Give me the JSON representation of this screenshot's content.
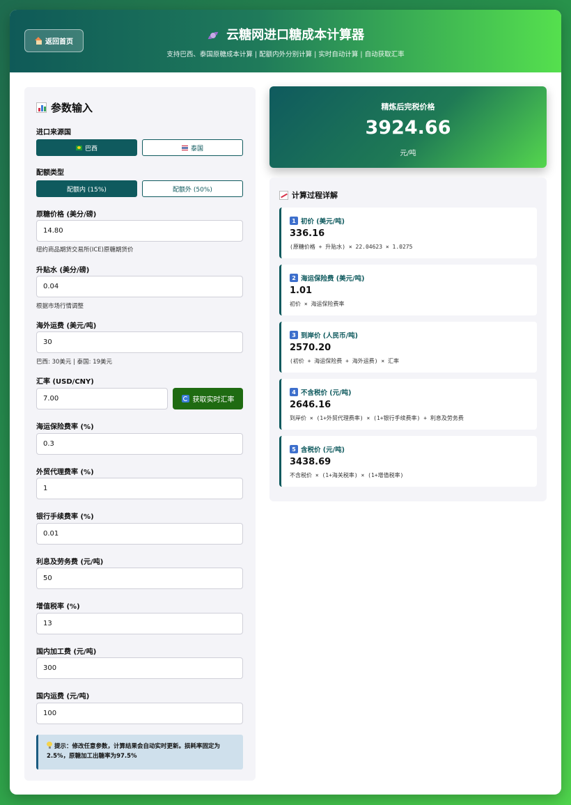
{
  "header": {
    "back_label": "返回首页",
    "title": "云糖网进口糖成本计算器",
    "subtitle": "支持巴西、泰国原糖成本计算 | 配额内外分别计算 | 实时自动计算 | 自动获取汇率"
  },
  "params": {
    "title": "参数输入",
    "origin_label": "进口来源国",
    "origin_options": [
      "巴西",
      "泰国"
    ],
    "origin_selected": "巴西",
    "quota_label": "配额类型",
    "quota_options": [
      "配额内 (15%)",
      "配额外 (50%)"
    ],
    "quota_selected": "配额内 (15%)",
    "raw_price": {
      "label": "原糖价格 (美分/磅)",
      "value": "14.80",
      "hint": "纽约商品期货交易所(ICE)原糖期货价"
    },
    "premium": {
      "label": "升贴水 (美分/磅)",
      "value": "0.04",
      "hint": "根据市场行情调整"
    },
    "freight": {
      "label": "海外运费 (美元/吨)",
      "value": "30",
      "hint": "巴西: 30美元 | 泰国: 19美元"
    },
    "exchange_rate": {
      "label": "汇率 (USD/CNY)",
      "value": "7.00",
      "button": "获取实时汇率"
    },
    "insurance_rate": {
      "label": "海运保险费率 (%)",
      "value": "0.3"
    },
    "agency_rate": {
      "label": "外贸代理费率 (%)",
      "value": "1"
    },
    "bank_rate": {
      "label": "银行手续费率 (%)",
      "value": "0.01"
    },
    "interest_fee": {
      "label": "利息及劳务费 (元/吨)",
      "value": "50"
    },
    "vat_rate": {
      "label": "增值税率 (%)",
      "value": "13"
    },
    "processing_fee": {
      "label": "国内加工费 (元/吨)",
      "value": "300"
    },
    "domestic_freight": {
      "label": "国内运费 (元/吨)",
      "value": "100"
    },
    "tip": "提示：修改任意参数，计算结果会自动实时更新。损耗率固定为2.5%，原糖加工出糖率为97.5%"
  },
  "result": {
    "label": "精炼后完税价格",
    "value": "3924.66",
    "unit": "元/吨"
  },
  "details": {
    "title": "计算过程详解",
    "steps": [
      {
        "num": "1",
        "name": "初价 (美元/吨)",
        "value": "336.16",
        "formula": "(原糖价格 + 升贴水) × 22.04623 × 1.0275"
      },
      {
        "num": "2",
        "name": "海运保险费 (美元/吨)",
        "value": "1.01",
        "formula": "初价 × 海运保险费率"
      },
      {
        "num": "3",
        "name": "到岸价 (人民币/吨)",
        "value": "2570.20",
        "formula": "(初价 + 海运保险费 + 海外运费) × 汇率"
      },
      {
        "num": "4",
        "name": "不含税价 (元/吨)",
        "value": "2646.16",
        "formula": "到岸价 × (1+外贸代理费率) × (1+银行手续费率) + 利息及劳务费"
      },
      {
        "num": "5",
        "name": "含税价 (元/吨)",
        "value": "3438.69",
        "formula": "不含税价 × (1+海关税率) × (1+增值税率)"
      }
    ]
  },
  "colors": {
    "primary": "#0f5a5e",
    "accent_green": "#55e04e",
    "rate_button": "#1f6b12"
  }
}
